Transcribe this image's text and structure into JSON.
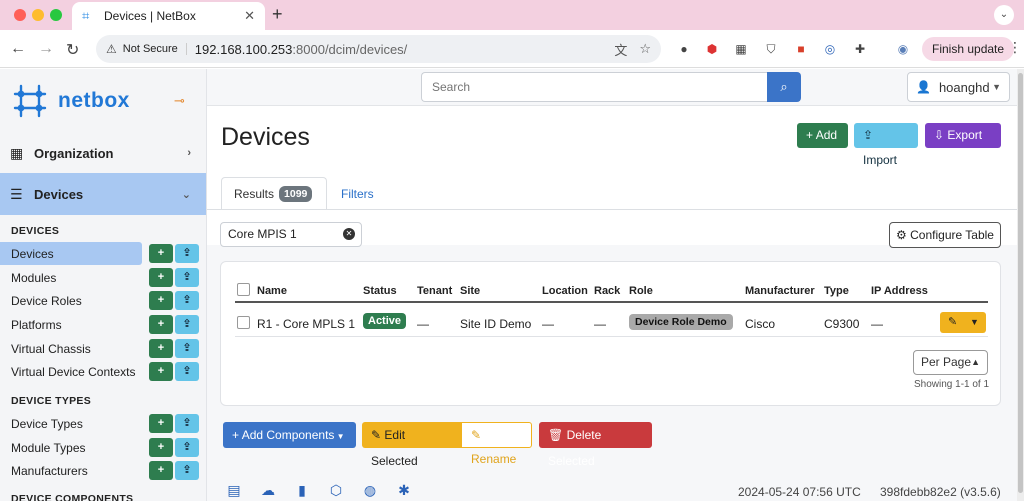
{
  "browser": {
    "tab_title": "Devices | NetBox",
    "security_label": "Not Secure",
    "url_host": "192.168.100.253",
    "url_rest": ":8000/dcim/devices/",
    "finish_update": "Finish update"
  },
  "sidebar": {
    "logo_text": "netbox",
    "groups": [
      {
        "label": "Organization"
      },
      {
        "label": "Devices"
      }
    ],
    "sections": [
      {
        "heading": "DEVICES",
        "items": [
          {
            "label": "Devices"
          },
          {
            "label": "Modules"
          },
          {
            "label": "Device Roles"
          },
          {
            "label": "Platforms"
          },
          {
            "label": "Virtual Chassis"
          },
          {
            "label": "Virtual Device Contexts"
          }
        ]
      },
      {
        "heading": "DEVICE TYPES",
        "items": [
          {
            "label": "Device Types"
          },
          {
            "label": "Module Types"
          },
          {
            "label": "Manufacturers"
          }
        ]
      },
      {
        "heading": "DEVICE COMPONENTS",
        "items": []
      }
    ]
  },
  "header": {
    "search_placeholder": "Search",
    "username": "hoanghd"
  },
  "page": {
    "title": "Devices",
    "add_label": "Add",
    "import_label": "Import",
    "export_label": "Export",
    "tabs": {
      "results_label": "Results",
      "results_count": "1099",
      "filters_label": "Filters"
    },
    "filter_chip": "Core MPIS 1",
    "configure_table": "Configure Table"
  },
  "table": {
    "columns": [
      "Name",
      "Status",
      "Tenant",
      "Site",
      "Location",
      "Rack",
      "Role",
      "Manufacturer",
      "Type",
      "IP Address"
    ],
    "rows": [
      {
        "name": "R1 - Core MPLS 1",
        "status": "Active",
        "tenant": "—",
        "site": "Site ID Demo",
        "location": "—",
        "rack": "—",
        "role": "Device Role Demo",
        "manufacturer": "Cisco",
        "type": "C9300",
        "ip_address": "—"
      }
    ],
    "per_page_label": "Per Page",
    "showing": "Showing 1-1 of 1"
  },
  "bulk_actions": {
    "add_components": "Add Components",
    "edit_selected": "Edit Selected",
    "rename": "Rename",
    "delete_selected": "Delete Selected"
  },
  "footer": {
    "timestamp": "2024-05-24 07:56 UTC",
    "version": "398fdebb82e2 (v3.5.6)",
    "icons": [
      "book-icon",
      "cloud-download-icon",
      "bookmark-icon",
      "graphql-icon",
      "github-icon",
      "slack-icon"
    ]
  },
  "colors": {
    "brand_blue": "#2178d6",
    "active_nav": "#a8c8f2",
    "success": "#2e7d4f",
    "info": "#64c4e8",
    "purple": "#7a3fc4",
    "warning": "#f0b21e",
    "danger": "#c93a3d",
    "primary": "#3b74c8"
  }
}
